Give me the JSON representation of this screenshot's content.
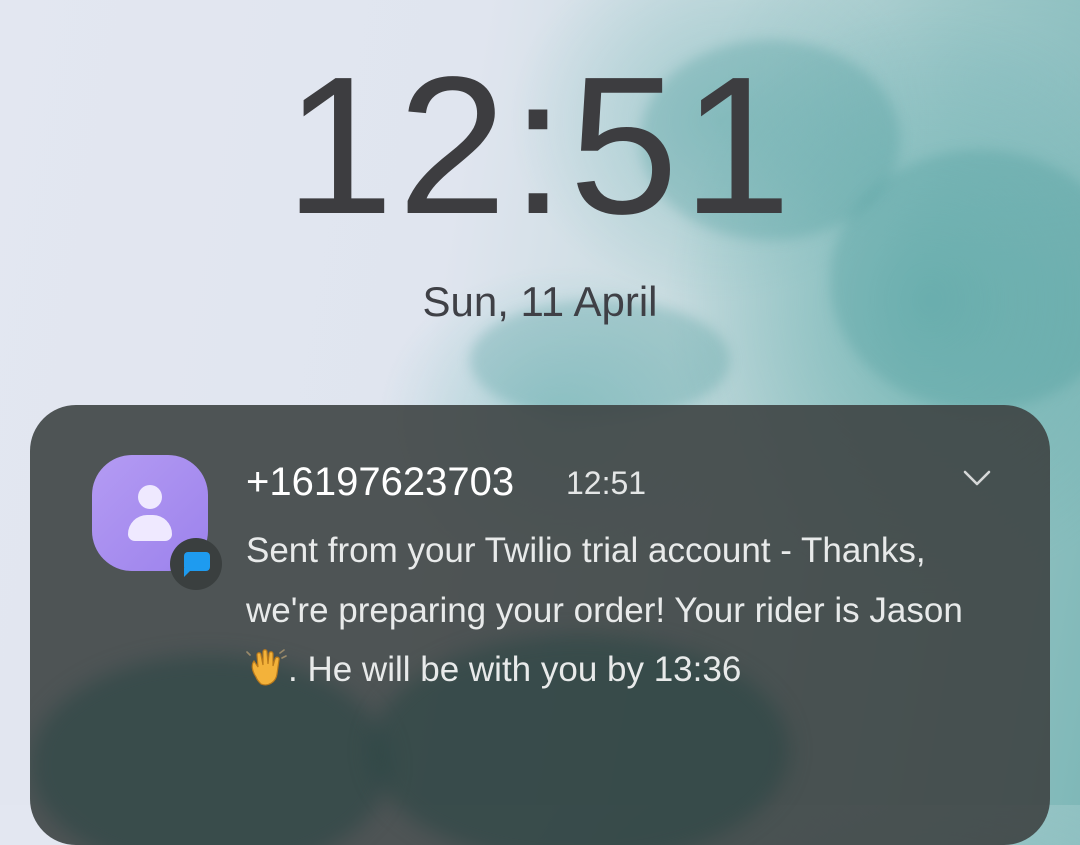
{
  "lockscreen": {
    "time": "12:51",
    "date": "Sun, 11 April"
  },
  "notification": {
    "app_icon": "messages-person-icon",
    "badge_icon": "chat-bubble-icon",
    "sender": "+16197623703",
    "time": "12:51",
    "expand_icon": "chevron-down-icon",
    "message_part1": "Sent from your Twilio trial account - Thanks, we're preparing your order! Your rider is Jason ",
    "emoji": "👋",
    "message_part2": ". He will be with you by 13:36"
  },
  "colors": {
    "avatar": "#a58cee",
    "badge": "#1e9bf0",
    "card": "#3e4444"
  }
}
